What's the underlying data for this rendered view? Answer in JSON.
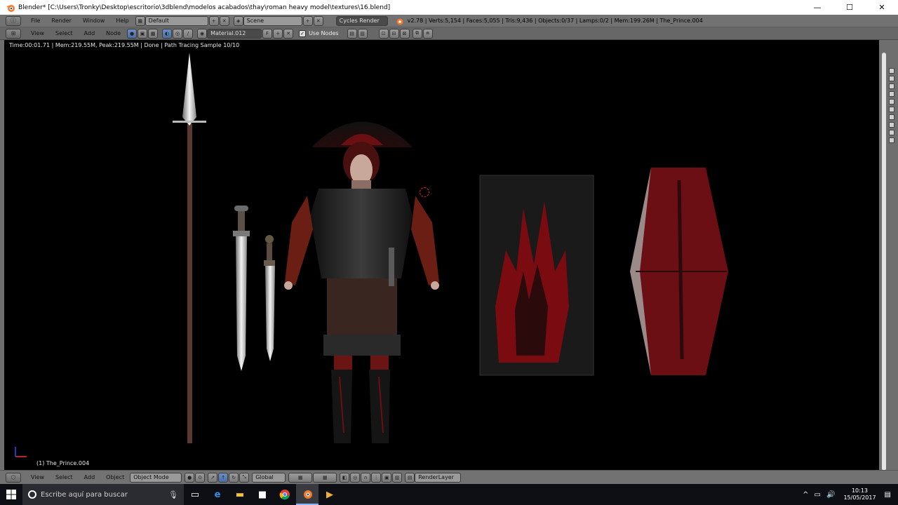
{
  "window": {
    "title": "Blender* [C:\\Users\\Tronky\\Desktop\\escritorio\\3dblend\\modelos acabados\\thay\\roman heavy model\\textures\\16.blend]",
    "minimize_glyph": "—",
    "maximize_glyph": "☐",
    "close_glyph": "✕"
  },
  "info_header": {
    "menus": [
      "File",
      "Render",
      "Window",
      "Help"
    ],
    "layout": "Default",
    "scene": "Scene",
    "engine": "Cycles Render",
    "stats": "v2.78 | Verts:5,154 | Faces:5,055 | Tris:9,436 | Objects:0/37 | Lamps:0/2 | Mem:199.26M | The_Prince.004"
  },
  "node_header": {
    "menus": [
      "View",
      "Select",
      "Add",
      "Node"
    ],
    "material": "Material.012",
    "fake_user": "F",
    "use_nodes_label": "Use Nodes"
  },
  "viewport": {
    "render_status": "Time:00:01.71 | Mem:219.55M, Peak:219.55M | Done | Path Tracing Sample 10/10",
    "object_label": "(1) The_Prince.004"
  },
  "view3d_header": {
    "menus": [
      "View",
      "Select",
      "Add",
      "Object"
    ],
    "mode": "Object Mode",
    "orientation": "Global",
    "render_layer": "RenderLayer"
  },
  "taskbar": {
    "search_placeholder": "Escribe aquí para buscar",
    "time": "10:13",
    "date": "15/05/2017"
  },
  "icons": [
    "blender-logo-icon",
    "windows-start-icon",
    "search-icon",
    "microphone-icon",
    "task-view-icon",
    "edge-icon",
    "file-explorer-icon",
    "store-icon",
    "chrome-icon",
    "blender-taskbar-icon",
    "media-player-icon",
    "notification-icon"
  ]
}
